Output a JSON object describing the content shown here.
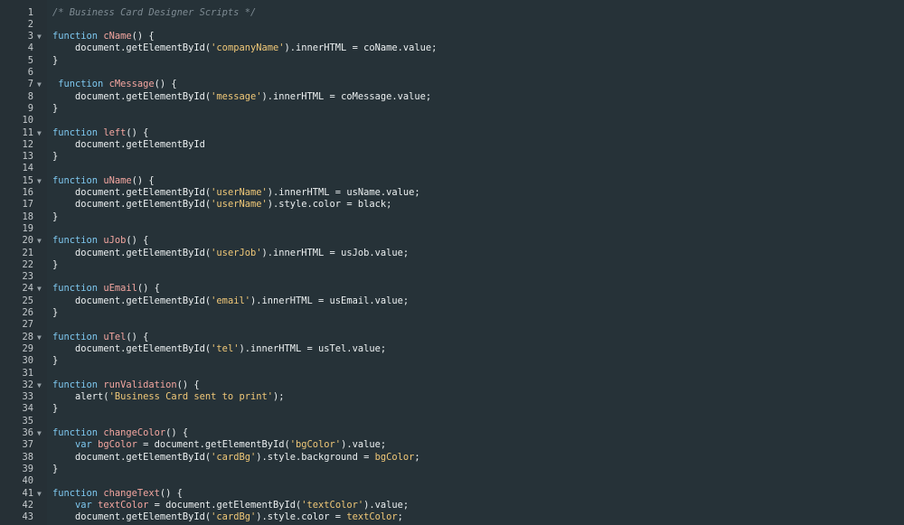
{
  "editor": {
    "lines": [
      {
        "n": "1",
        "fold": false,
        "parts": [
          {
            "t": "/* Business Card Designer Scripts */",
            "c": "cm"
          }
        ]
      },
      {
        "n": "2",
        "fold": false,
        "parts": []
      },
      {
        "n": "3",
        "fold": true,
        "parts": [
          {
            "t": "function ",
            "c": "kw"
          },
          {
            "t": "cName",
            "c": "fn"
          },
          {
            "t": "() {",
            "c": "pl"
          }
        ]
      },
      {
        "n": "4",
        "fold": false,
        "parts": [
          {
            "t": "    document.getElementById(",
            "c": "pl"
          },
          {
            "t": "'companyName'",
            "c": "str"
          },
          {
            "t": ").innerHTML = coName.value;",
            "c": "pl"
          }
        ]
      },
      {
        "n": "5",
        "fold": false,
        "parts": [
          {
            "t": "}",
            "c": "pl"
          }
        ]
      },
      {
        "n": "6",
        "fold": false,
        "parts": []
      },
      {
        "n": "7",
        "fold": true,
        "parts": [
          {
            "t": " function ",
            "c": "kw"
          },
          {
            "t": "cMessage",
            "c": "fn"
          },
          {
            "t": "() {",
            "c": "pl"
          }
        ]
      },
      {
        "n": "8",
        "fold": false,
        "parts": [
          {
            "t": "    document.getElementById(",
            "c": "pl"
          },
          {
            "t": "'message'",
            "c": "str"
          },
          {
            "t": ").innerHTML = coMessage.value;",
            "c": "pl"
          }
        ]
      },
      {
        "n": "9",
        "fold": false,
        "parts": [
          {
            "t": "}",
            "c": "pl"
          }
        ]
      },
      {
        "n": "10",
        "fold": false,
        "parts": []
      },
      {
        "n": "11",
        "fold": true,
        "parts": [
          {
            "t": "function ",
            "c": "kw"
          },
          {
            "t": "left",
            "c": "fn"
          },
          {
            "t": "() {",
            "c": "pl"
          }
        ]
      },
      {
        "n": "12",
        "fold": false,
        "parts": [
          {
            "t": "    document.getElementById",
            "c": "pl"
          }
        ]
      },
      {
        "n": "13",
        "fold": false,
        "parts": [
          {
            "t": "}",
            "c": "pl"
          }
        ]
      },
      {
        "n": "14",
        "fold": false,
        "parts": []
      },
      {
        "n": "15",
        "fold": true,
        "parts": [
          {
            "t": "function ",
            "c": "kw"
          },
          {
            "t": "uName",
            "c": "fn"
          },
          {
            "t": "() {",
            "c": "pl"
          }
        ]
      },
      {
        "n": "16",
        "fold": false,
        "parts": [
          {
            "t": "    document.getElementById(",
            "c": "pl"
          },
          {
            "t": "'userName'",
            "c": "str"
          },
          {
            "t": ").innerHTML = usName.value;",
            "c": "pl"
          }
        ]
      },
      {
        "n": "17",
        "fold": false,
        "parts": [
          {
            "t": "    document.getElementById(",
            "c": "pl"
          },
          {
            "t": "'userName'",
            "c": "str"
          },
          {
            "t": ").style.color = black;",
            "c": "pl"
          }
        ]
      },
      {
        "n": "18",
        "fold": false,
        "parts": [
          {
            "t": "}",
            "c": "pl"
          }
        ]
      },
      {
        "n": "19",
        "fold": false,
        "parts": []
      },
      {
        "n": "20",
        "fold": true,
        "parts": [
          {
            "t": "function ",
            "c": "kw"
          },
          {
            "t": "uJob",
            "c": "fn"
          },
          {
            "t": "() {",
            "c": "pl"
          }
        ]
      },
      {
        "n": "21",
        "fold": false,
        "parts": [
          {
            "t": "    document.getElementById(",
            "c": "pl"
          },
          {
            "t": "'userJob'",
            "c": "str"
          },
          {
            "t": ").innerHTML = usJob.value;",
            "c": "pl"
          }
        ]
      },
      {
        "n": "22",
        "fold": false,
        "parts": [
          {
            "t": "}",
            "c": "pl"
          }
        ]
      },
      {
        "n": "23",
        "fold": false,
        "parts": []
      },
      {
        "n": "24",
        "fold": true,
        "parts": [
          {
            "t": "function ",
            "c": "kw"
          },
          {
            "t": "uEmail",
            "c": "fn"
          },
          {
            "t": "() {",
            "c": "pl"
          }
        ]
      },
      {
        "n": "25",
        "fold": false,
        "parts": [
          {
            "t": "    document.getElementById(",
            "c": "pl"
          },
          {
            "t": "'email'",
            "c": "str"
          },
          {
            "t": ").innerHTML = usEmail.value;",
            "c": "pl"
          }
        ]
      },
      {
        "n": "26",
        "fold": false,
        "parts": [
          {
            "t": "}",
            "c": "pl"
          }
        ]
      },
      {
        "n": "27",
        "fold": false,
        "parts": []
      },
      {
        "n": "28",
        "fold": true,
        "parts": [
          {
            "t": "function ",
            "c": "kw"
          },
          {
            "t": "uTel",
            "c": "fn"
          },
          {
            "t": "() {",
            "c": "pl"
          }
        ]
      },
      {
        "n": "29",
        "fold": false,
        "parts": [
          {
            "t": "    document.getElementById(",
            "c": "pl"
          },
          {
            "t": "'tel'",
            "c": "str"
          },
          {
            "t": ").innerHTML = usTel.value;",
            "c": "pl"
          }
        ]
      },
      {
        "n": "30",
        "fold": false,
        "parts": [
          {
            "t": "}",
            "c": "pl"
          }
        ]
      },
      {
        "n": "31",
        "fold": false,
        "parts": []
      },
      {
        "n": "32",
        "fold": true,
        "parts": [
          {
            "t": "function ",
            "c": "kw"
          },
          {
            "t": "runValidation",
            "c": "fn"
          },
          {
            "t": "() {",
            "c": "pl"
          }
        ]
      },
      {
        "n": "33",
        "fold": false,
        "parts": [
          {
            "t": "    alert(",
            "c": "pl"
          },
          {
            "t": "'Business Card sent to print'",
            "c": "str"
          },
          {
            "t": ");",
            "c": "pl"
          }
        ]
      },
      {
        "n": "34",
        "fold": false,
        "parts": [
          {
            "t": "}",
            "c": "pl"
          }
        ]
      },
      {
        "n": "35",
        "fold": false,
        "parts": []
      },
      {
        "n": "36",
        "fold": true,
        "parts": [
          {
            "t": "function ",
            "c": "kw"
          },
          {
            "t": "changeColor",
            "c": "fn"
          },
          {
            "t": "() {",
            "c": "pl"
          }
        ]
      },
      {
        "n": "37",
        "fold": false,
        "parts": [
          {
            "t": "    ",
            "c": "pl"
          },
          {
            "t": "var ",
            "c": "kw"
          },
          {
            "t": "bgColor",
            "c": "fn"
          },
          {
            "t": " = document.getElementById(",
            "c": "pl"
          },
          {
            "t": "'bgColor'",
            "c": "str"
          },
          {
            "t": ").value;",
            "c": "pl"
          }
        ]
      },
      {
        "n": "38",
        "fold": false,
        "parts": [
          {
            "t": "    document.getElementById(",
            "c": "pl"
          },
          {
            "t": "'cardBg'",
            "c": "str"
          },
          {
            "t": ").style.background = ",
            "c": "pl"
          },
          {
            "t": "bgColor",
            "c": "str"
          },
          {
            "t": ";",
            "c": "pl"
          }
        ]
      },
      {
        "n": "39",
        "fold": false,
        "parts": [
          {
            "t": "}",
            "c": "pl"
          }
        ]
      },
      {
        "n": "40",
        "fold": false,
        "parts": []
      },
      {
        "n": "41",
        "fold": true,
        "parts": [
          {
            "t": "function ",
            "c": "kw"
          },
          {
            "t": "changeText",
            "c": "fn"
          },
          {
            "t": "() {",
            "c": "pl"
          }
        ]
      },
      {
        "n": "42",
        "fold": false,
        "parts": [
          {
            "t": "    ",
            "c": "pl"
          },
          {
            "t": "var ",
            "c": "kw"
          },
          {
            "t": "textColor",
            "c": "fn"
          },
          {
            "t": " = document.getElementById(",
            "c": "pl"
          },
          {
            "t": "'textColor'",
            "c": "str"
          },
          {
            "t": ").value;",
            "c": "pl"
          }
        ]
      },
      {
        "n": "43",
        "fold": false,
        "parts": [
          {
            "t": "    document.getElementById(",
            "c": "pl"
          },
          {
            "t": "'cardBg'",
            "c": "str"
          },
          {
            "t": ").style.color = ",
            "c": "pl"
          },
          {
            "t": "textColor",
            "c": "str"
          },
          {
            "t": ";",
            "c": "pl"
          }
        ]
      }
    ],
    "fold_icon": "fold-arrow-icon",
    "colors": {
      "background": "#263238",
      "keyword": "#7ec8f0",
      "function_name": "#f4a6a0",
      "string": "#f0c878",
      "comment": "#7d8a92",
      "plain": "#ecf0f1"
    }
  }
}
